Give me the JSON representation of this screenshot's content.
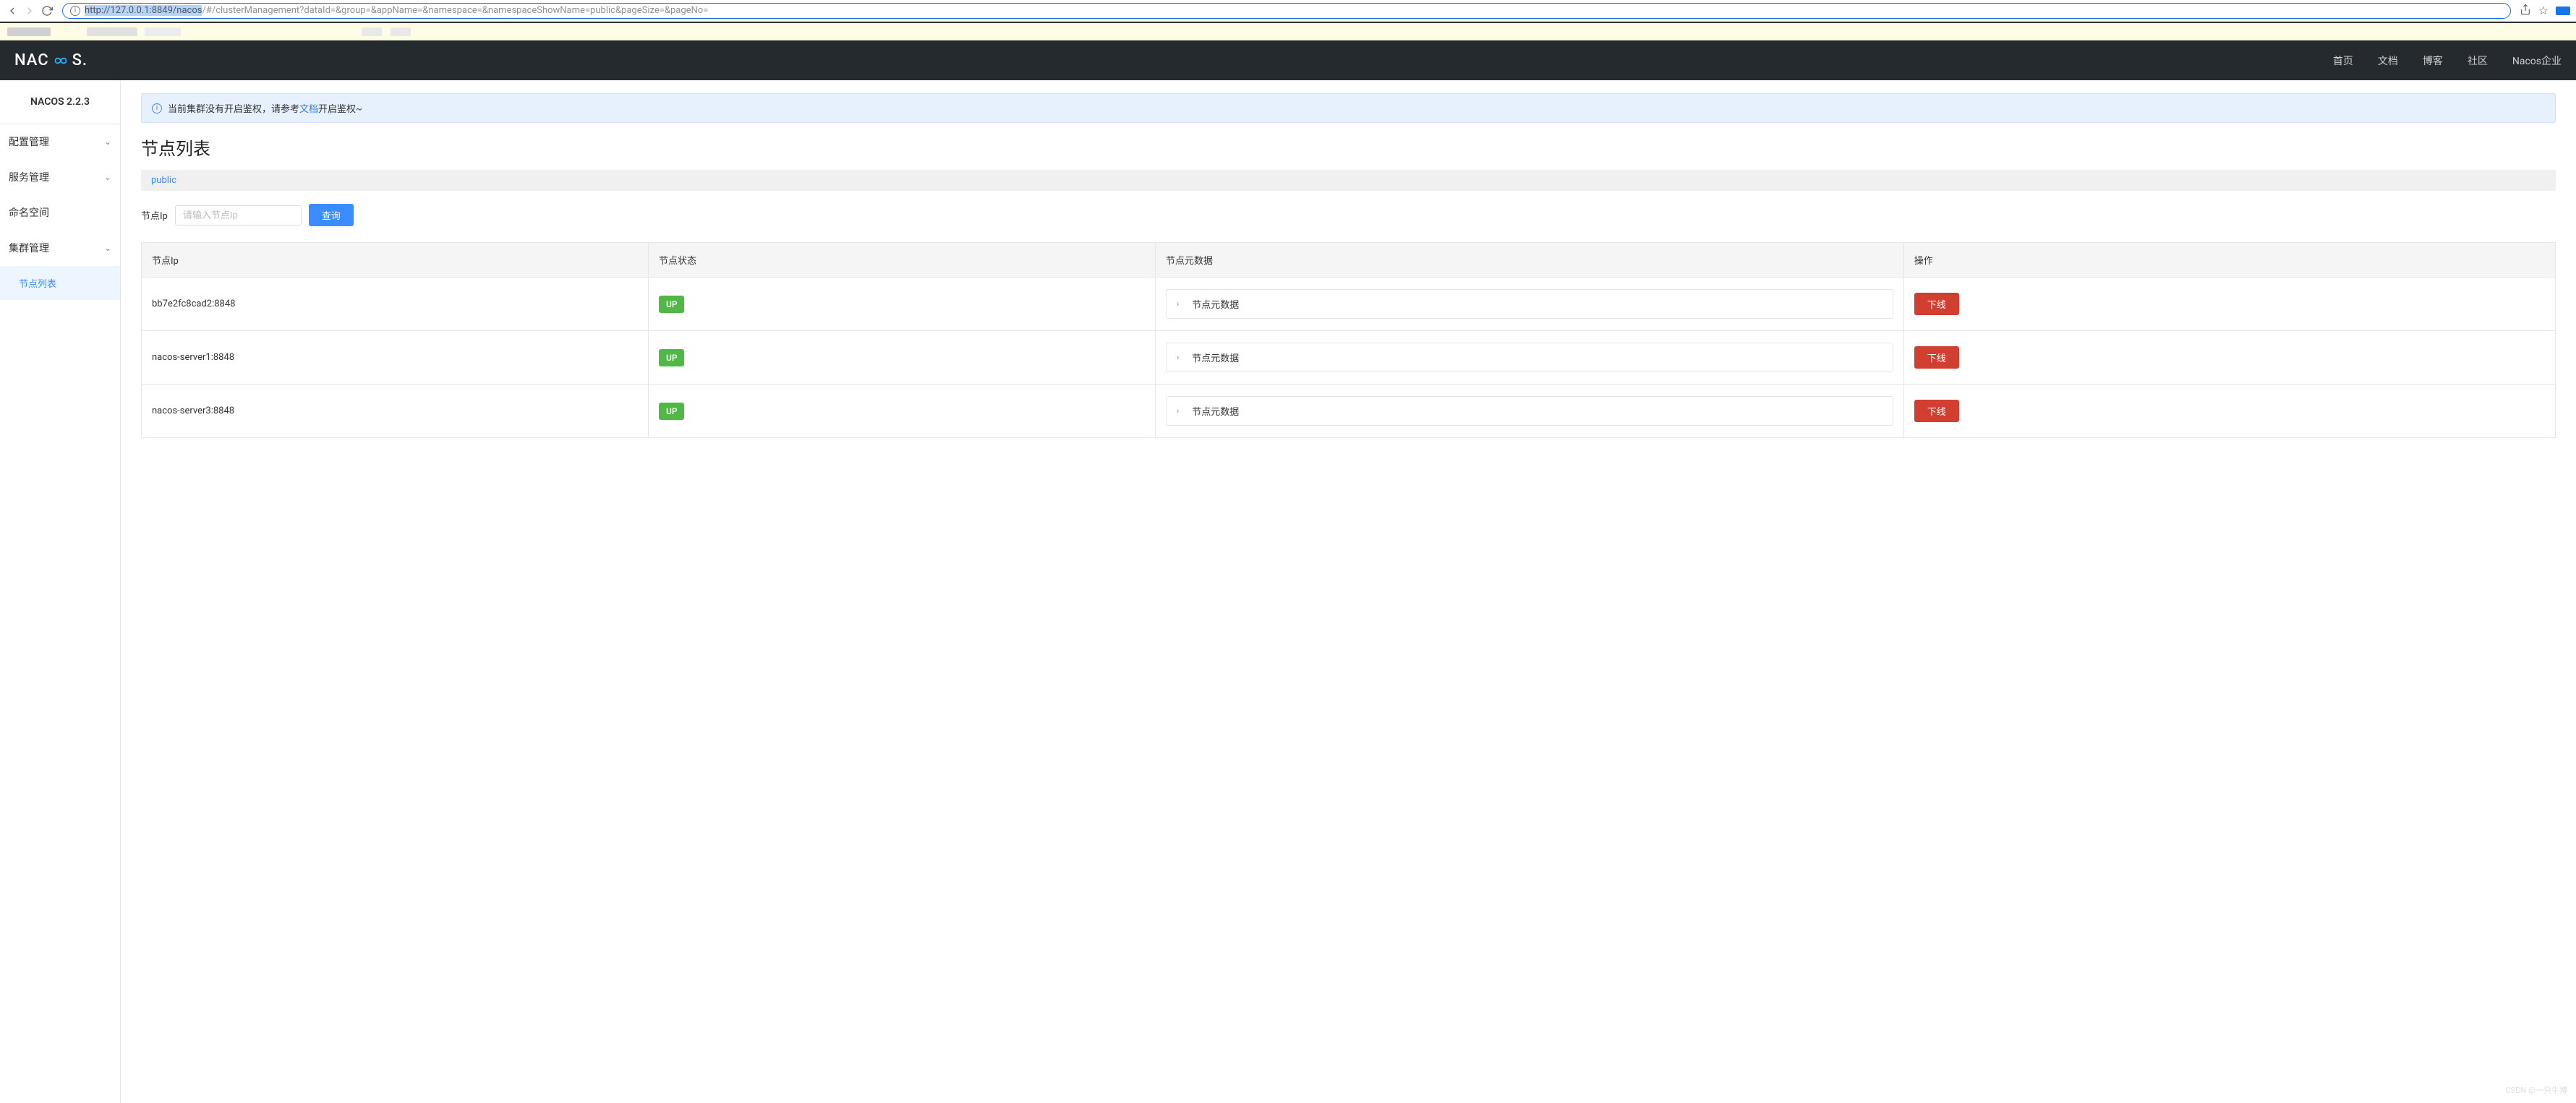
{
  "browser": {
    "url_highlighted": "http://127.0.0.1:8849/nacos",
    "url_rest": "/#/clusterManagement?dataId=&group=&appName=&namespace=&namespaceShowName=public&pageSize=&pageNo="
  },
  "header": {
    "logo_left": "NAC",
    "logo_right": "S.",
    "nav": [
      "首页",
      "文档",
      "博客",
      "社区",
      "Nacos企业"
    ]
  },
  "sidebar": {
    "title": "NACOS 2.2.3",
    "menu": [
      {
        "label": "配置管理",
        "expandable": true
      },
      {
        "label": "服务管理",
        "expandable": true
      },
      {
        "label": "命名空间",
        "expandable": false
      },
      {
        "label": "集群管理",
        "expandable": true
      }
    ],
    "active_submenu": "节点列表"
  },
  "content": {
    "notice_prefix": "当前集群没有开启鉴权，请参考",
    "notice_link": "文档",
    "notice_suffix": "开启鉴权~",
    "page_title": "节点列表",
    "namespace": "public",
    "search_label": "节点Ip",
    "search_placeholder": "请输入节点Ip",
    "search_button": "查询",
    "table": {
      "columns": [
        "节点Ip",
        "节点状态",
        "节点元数据",
        "操作"
      ],
      "meta_expand_label": "节点元数据",
      "action_label": "下线",
      "rows": [
        {
          "ip": "bb7e2fc8cad2:8848",
          "status": "UP"
        },
        {
          "ip": "nacos-server1:8848",
          "status": "UP"
        },
        {
          "ip": "nacos-server3:8848",
          "status": "UP"
        }
      ]
    }
  },
  "watermark": "CSDN @一只牛博"
}
